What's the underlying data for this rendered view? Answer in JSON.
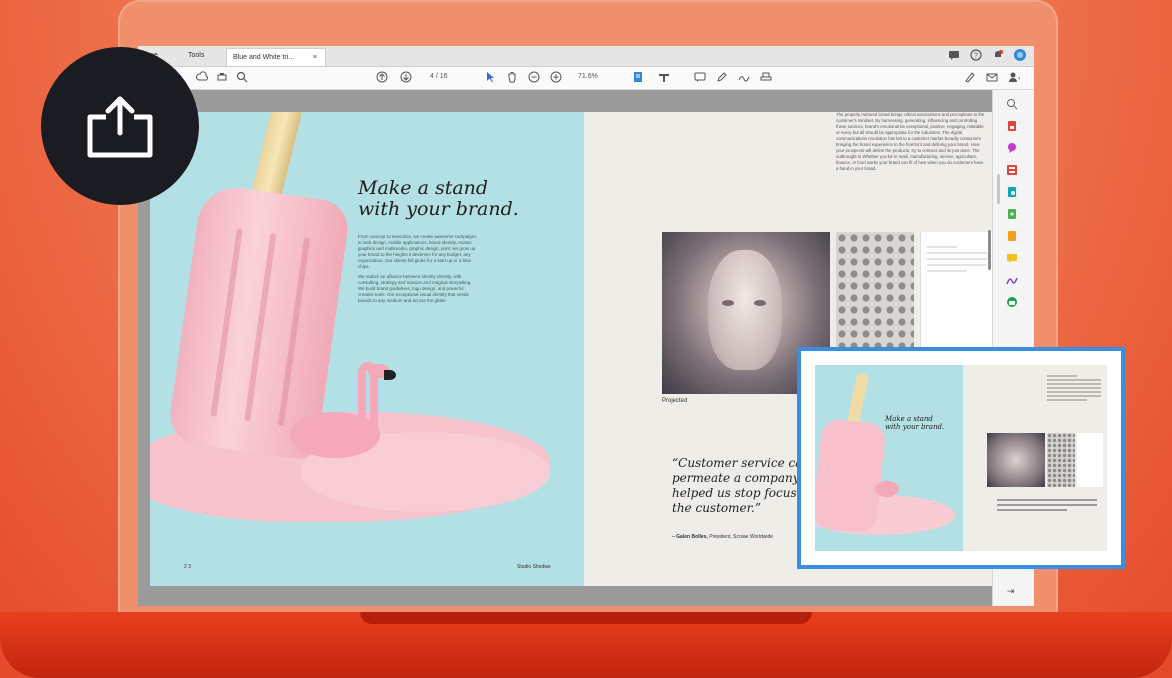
{
  "app": {
    "tabs": [
      "me",
      "Tools"
    ],
    "document_tab": {
      "label": "Blue and White tri...",
      "close": "×"
    }
  },
  "toolbar": {
    "page_indicator": "4  / 16",
    "zoom": "71.6%"
  },
  "document": {
    "left_page": {
      "headline_line1": "Make a stand",
      "headline_line2": "with your brand.",
      "paragraphs": [
        "From concept to execution, we create awesome campaigns to web design, mobile applications, brand identity, motion graphics and multimedia, graphic design, print; we grow up your brand to the heights it deserves for any budget, any organization. Our clients fall globe for a start up or a blue chips.",
        "We realize an alliance between identity identity, with consulting, strategy and mission and magical storytelling. We build brand guidelines, logo design, and powerful creative tools. Our exceptional visual identity that sends brands to any medium and across the globe."
      ],
      "footer_left": "2  3",
      "footer_right": "Studio Shodwe"
    },
    "right_page": {
      "text_block": "The properly nurtured brand brings critical associations and perceptions to the customer's mindset. By harnessing, generating, influencing and controlling these sources, brand's emotional be exceptional, positive, engaging, relatable or every but all should be appropriate for the industries. The digital communications revolution has led to a customer market broadly consumers bringing the brand experience to the forefront and defining your brand. How your prospects will define the products, try to connect and its just done. The outbrought to Whether you be in retail, manufacturing, service, agriculture, finance, or food works your brand can fit of how when you do customers have a hand in your brand.",
      "image_caption": "Projected",
      "quote": "“Customer service cannot be a department, it must permeate a company like Dexinote. It is their brand, it helped us stop focusing on a logo so we could focus on the customer.”",
      "attribution_name": "– Galen Bolles,",
      "attribution_role": " President, Scoiae Worldwide"
    }
  },
  "icons": {
    "share": "share-upload-icon",
    "sidebar": [
      "zoom-icon",
      "export-pdf-icon",
      "comment-icon",
      "organize-icon",
      "edit-pdf-icon",
      "create-pdf-icon",
      "combine-icon",
      "sign-icon",
      "fill-sign-icon",
      "protect-icon"
    ]
  },
  "colors": {
    "accent_blue": "#3b8de0",
    "left_page_bg": "#b3e0e4",
    "right_page_bg": "#efede8",
    "share_button_bg": "#1b1b22"
  }
}
